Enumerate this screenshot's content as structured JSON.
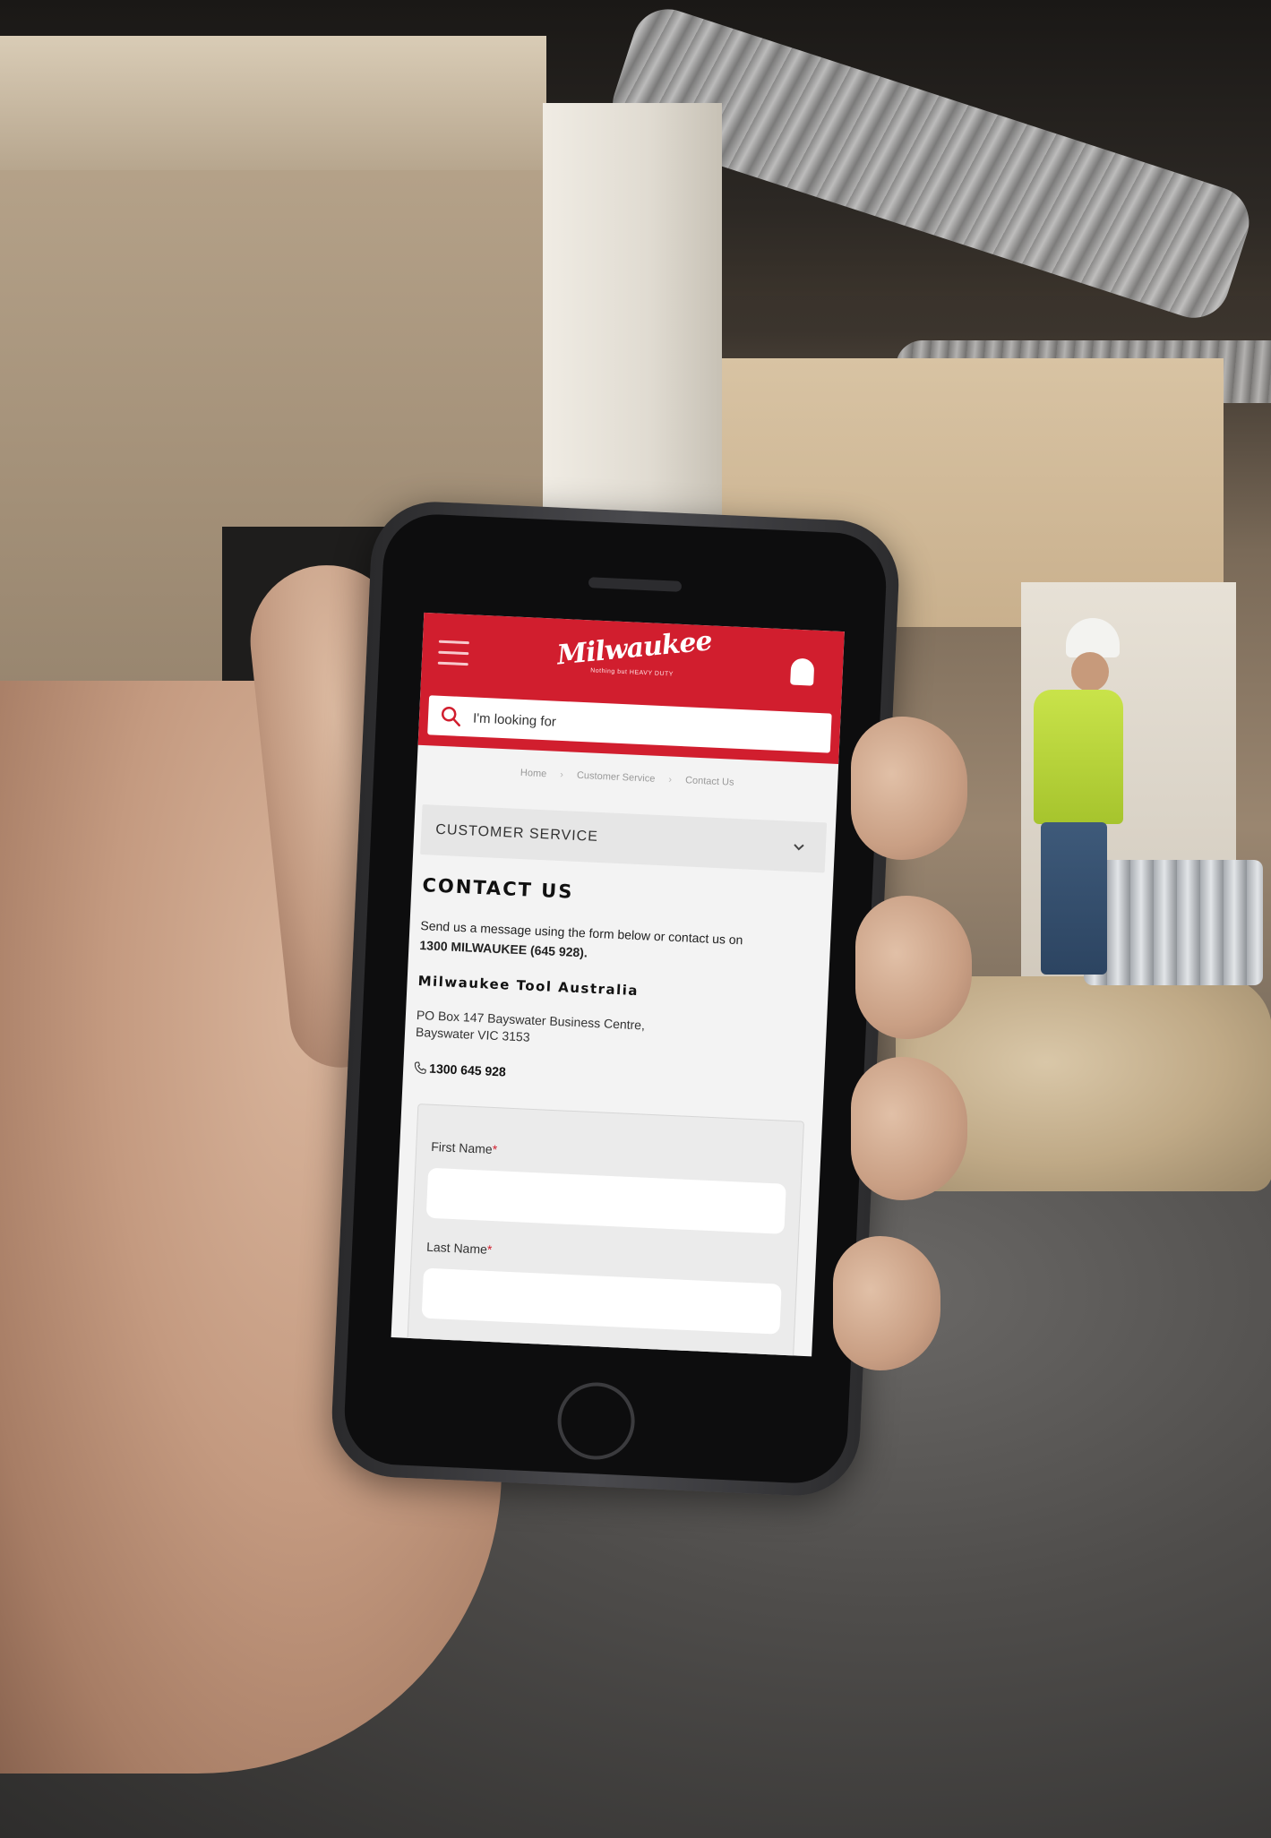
{
  "site": {
    "brand": "Milwaukee",
    "tagline": "Nothing but HEAVY DUTY",
    "search": {
      "placeholder": "I'm looking for"
    },
    "breadcrumb": [
      "Home",
      "Customer Service",
      "Contact Us"
    ],
    "breadcrumb_separator": "›",
    "accordion": {
      "label": "CUSTOMER SERVICE"
    },
    "contact": {
      "title": "CONTACT US",
      "intro_text": "Send us a message using the form below or contact us on",
      "intro_phone": "1300 MILWAUKEE (645 928).",
      "company_name": "Milwaukee Tool Australia",
      "address_line1": "PO Box 147 Bayswater Business Centre,",
      "address_line2": "Bayswater VIC 3153",
      "phone": "1300 645 928"
    },
    "form": {
      "first_name_label": "First Name",
      "last_name_label": "Last Name",
      "required_marker": "*"
    }
  },
  "colors": {
    "brand_red": "#d11e2e",
    "screen_bg": "#f3f3f3",
    "accordion_bg": "#e6e6e6"
  },
  "icons": {
    "menu": "hamburger-menu-icon",
    "account": "helmet-account-icon",
    "search": "search-icon",
    "accordion": "chevron-down-icon",
    "phone": "phone-icon"
  }
}
